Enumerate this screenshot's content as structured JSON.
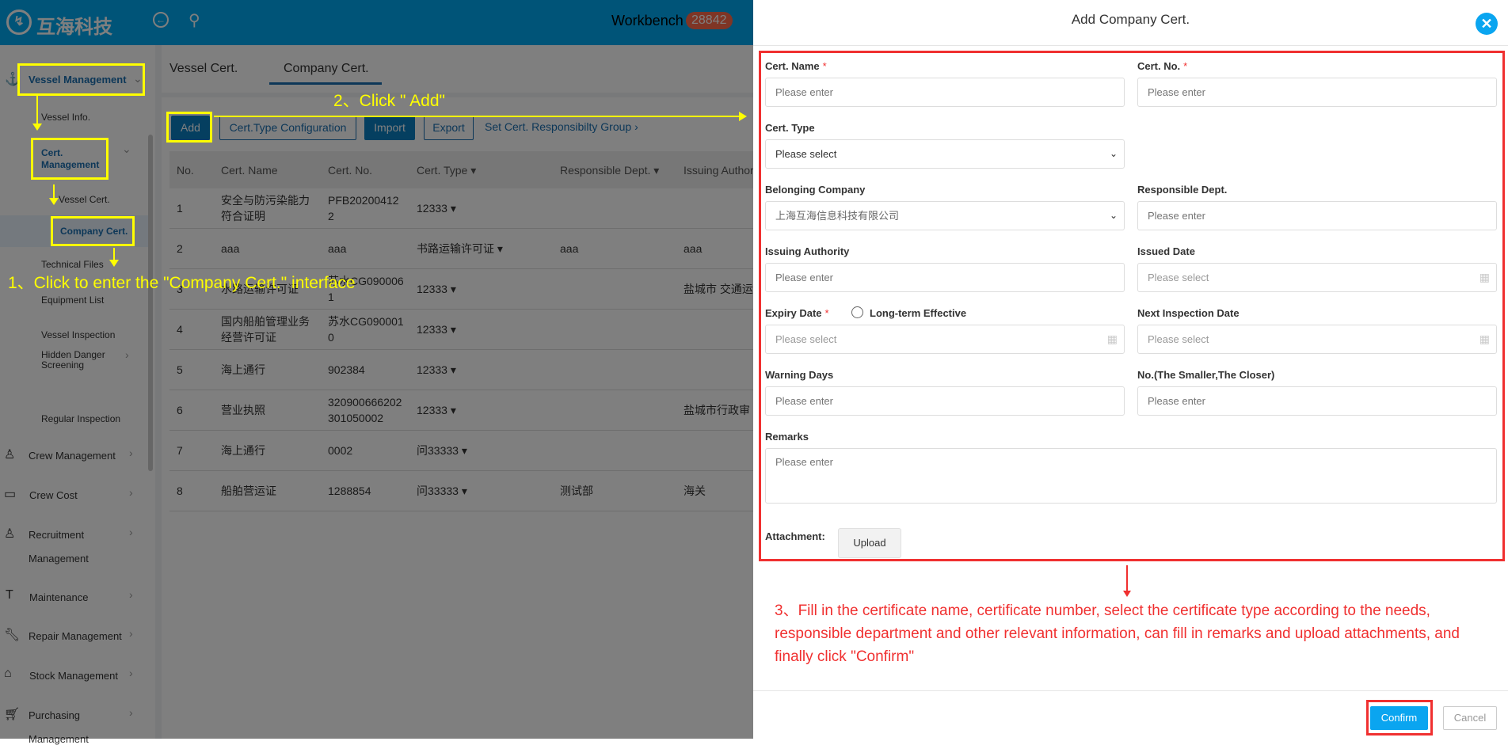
{
  "header": {
    "brand": "互海科技",
    "workbench": "Workbench",
    "badge": "28842"
  },
  "sidebar": {
    "vessel_management": "Vessel Management",
    "vessel_info": "Vessel Info.",
    "cert_management_1": "Cert.",
    "cert_management_2": "Management",
    "vessel_cert": "Vessel Cert.",
    "company_cert": "Company Cert.",
    "technical_files": "Technical Files",
    "equipment_list": "Equipment List",
    "vessel_inspection": "Vessel Inspection",
    "hidden_danger_1": "Hidden Danger",
    "hidden_danger_2": "Screening",
    "regular_inspection": "Regular Inspection",
    "crew_management": "Crew Management",
    "crew_cost": "Crew Cost",
    "recruitment_1": "Recruitment",
    "recruitment_2": "Management",
    "maintenance": "Maintenance",
    "repair": "Repair Management",
    "stock": "Stock Management",
    "purchasing_1": "Purchasing",
    "purchasing_2": "Management"
  },
  "tabs": [
    "Vessel Cert.",
    "Company Cert."
  ],
  "toolbar": {
    "add": "Add",
    "cert_type_config": "Cert.Type Configuration",
    "import": "Import",
    "export": "Export",
    "set_group": "Set Cert. Responsibilty Group"
  },
  "table": {
    "headers": [
      "No.",
      "Cert. Name",
      "Cert. No.",
      "Cert. Type",
      "Responsible Dept.",
      "Issuing Authority"
    ],
    "rows": [
      {
        "no": "1",
        "name": "安全与防污染能力\n符合证明",
        "cert_no": "PFB20200412\n2",
        "type": "12333",
        "dept": "",
        "auth": ""
      },
      {
        "no": "2",
        "name": "aaa",
        "cert_no": "aaa",
        "type": "书路运输许可证",
        "dept": "aaa",
        "auth": "aaa"
      },
      {
        "no": "3",
        "name": "水路运输许可证",
        "cert_no": "苏水CG090006\n1",
        "type": "12333",
        "dept": "",
        "auth": "盐城市 交通运"
      },
      {
        "no": "4",
        "name": "国内船舶管理业务\n经营许可证",
        "cert_no": "苏水CG090001\n0",
        "type": "12333",
        "dept": "",
        "auth": ""
      },
      {
        "no": "5",
        "name": "海上通行",
        "cert_no": "902384",
        "type": "12333",
        "dept": "",
        "auth": ""
      },
      {
        "no": "6",
        "name": "营业执照",
        "cert_no": "320900666202\n301050002",
        "type": "12333",
        "dept": "",
        "auth": "盐城市行政审"
      },
      {
        "no": "7",
        "name": "海上通行",
        "cert_no": "0002",
        "type": "问33333",
        "dept": "",
        "auth": ""
      },
      {
        "no": "8",
        "name": "船舶营运证",
        "cert_no": "1288854",
        "type": "问33333",
        "dept": "测试部",
        "auth": "海关"
      }
    ]
  },
  "annotations": {
    "step1": "1、Click to enter the \"Company Cert.\" interface",
    "step2": "2、Click \" Add\"",
    "step3": "3、Fill in the certificate name, certificate number, select the certificate type according to the needs, responsible department and other relevant information, can fill in remarks and upload attachments, and finally click \"Confirm\""
  },
  "modal": {
    "title": "Add Company Cert.",
    "cert_name": {
      "label": "Cert. Name",
      "placeholder": "Please enter"
    },
    "cert_no": {
      "label": "Cert. No.",
      "placeholder": "Please enter"
    },
    "cert_type": {
      "label": "Cert. Type",
      "value": "Please select"
    },
    "company": {
      "label": "Belonging Company",
      "value": "上海互海信息科技有限公司"
    },
    "dept": {
      "label": "Responsible Dept.",
      "placeholder": "Please enter"
    },
    "authority": {
      "label": "Issuing Authority",
      "placeholder": "Please enter"
    },
    "issued": {
      "label": "Issued Date",
      "placeholder": "Please select"
    },
    "expiry": {
      "label": "Expiry Date",
      "placeholder": "Please select",
      "long_term": "Long-term Effective"
    },
    "next_insp": {
      "label": "Next Inspection Date",
      "placeholder": "Please select"
    },
    "warning": {
      "label": "Warning Days",
      "placeholder": "Please enter"
    },
    "order": {
      "label": "No.(The Smaller,The Closer)",
      "placeholder": "Please enter"
    },
    "remarks": {
      "label": "Remarks",
      "placeholder": "Please enter"
    },
    "attachment": "Attachment:",
    "upload": "Upload",
    "required": "*",
    "confirm": "Confirm",
    "cancel": "Cancel"
  },
  "colors": {
    "accent": "#0aa5f0",
    "annotation_yellow": "#ffff00",
    "annotation_red": "#f03030"
  }
}
